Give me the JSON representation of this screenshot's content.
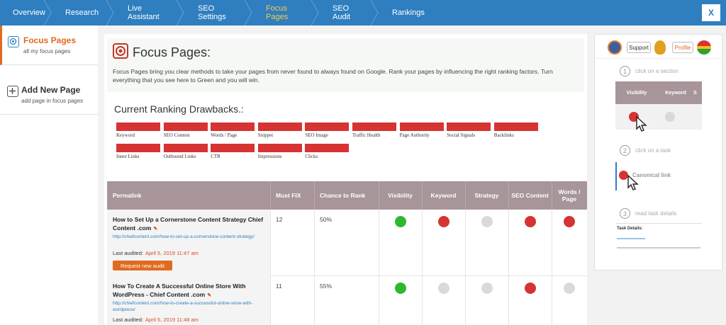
{
  "nav": {
    "items": [
      "Overview",
      "Research",
      "Live Assistant",
      "SEO Settings",
      "Focus Pages",
      "SEO Audit",
      "Rankings"
    ],
    "active_index": 4,
    "close_label": "X"
  },
  "sidebar": {
    "items": [
      {
        "title": "Focus Pages",
        "sub": "all my focus pages",
        "active": true,
        "icon": "target-icon"
      },
      {
        "title": "Add New Page",
        "sub": "add page in focus pages",
        "active": false,
        "icon": "plus-box-icon"
      }
    ]
  },
  "intro": {
    "title": "Focus Pages:",
    "text": "Focus Pages bring you clear methods to take your pages from never found to always found on Google. Rank your pages by influencing the right ranking factors. Turn everything that you see here to Green and you will win."
  },
  "drawbacks": {
    "title": "Current Ranking Drawbacks.:",
    "items": [
      "Keyword",
      "SEO Content",
      "Words / Page",
      "Snippet",
      "SEO Image",
      "Traffic Health",
      "Page Authority",
      "Social Signals",
      "Backlinks",
      "Inner Links",
      "Outbound Links",
      "CTR",
      "Impressions",
      "Clicks"
    ],
    "color": "#d63333"
  },
  "table": {
    "headers": [
      "Permalink",
      "Must FIX",
      "Chance to Rank",
      "Visibility",
      "Keyword",
      "Strategy",
      "SEO Content",
      "Words / Page"
    ],
    "rows": [
      {
        "title": "How to Set Up a Cornerstone Content Strategy Chief Content .com",
        "url": "http://chiefcontent.com/how-to-set-up-a-cornerstone-content-strategy/",
        "audit_label": "Last audited:",
        "audit_date": "April 5, 2019 11:47 am",
        "button": "Request new audit",
        "must_fix": "12",
        "chance": "50%",
        "dots": [
          "green",
          "red",
          "gray",
          "red",
          "red"
        ]
      },
      {
        "title": "How To Create A Successful Online Store With WordPress - Chief Content .com",
        "url": "http://chiefcontent.com/how-to-create-a-successful-online-store-with-wordpress/",
        "audit_label": "Last audited:",
        "audit_date": "April 5, 2019 11:48 am",
        "button": "",
        "must_fix": "11",
        "chance": "55%",
        "dots": [
          "green",
          "gray",
          "gray",
          "red",
          "gray"
        ]
      }
    ],
    "colors": {
      "green": "#2eb82e",
      "red": "#d63333",
      "gray": "#d9d9d9",
      "header": "#a7959a"
    }
  },
  "rpanel": {
    "support_label": "Support",
    "profile_label": "Profile",
    "steps": [
      {
        "num": "1",
        "text": "click on a section"
      },
      {
        "num": "2",
        "text": "click on a task"
      },
      {
        "num": "3",
        "text": "read task details"
      }
    ],
    "mini_headers": [
      "Visibility",
      "Keyword",
      "S"
    ],
    "task_label": "Canonical link",
    "details_label": "Task Details:"
  }
}
